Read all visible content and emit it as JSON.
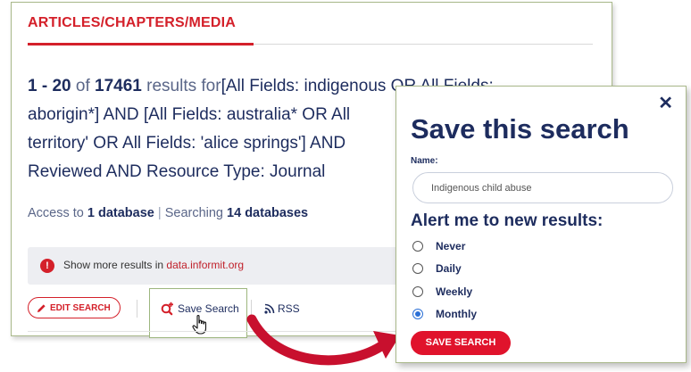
{
  "section": {
    "heading": "ARTICLES/CHAPTERS/MEDIA"
  },
  "results": {
    "range": "1 - 20",
    "of_word": "of",
    "total": "17461",
    "results_for": "results for",
    "line1_query": "[All Fields: indigenous OR All Fields:",
    "line2": "aborigin*] AND [All Fields: australia* OR All",
    "line3": "territory' OR All Fields: 'alice springs'] AND",
    "line4": "Reviewed AND Resource Type: Journal"
  },
  "access": {
    "access_to": "Access to",
    "db_count": "1 database",
    "separator": "|",
    "searching": "Searching",
    "searching_count": "14 databases"
  },
  "notice": {
    "icon": "!",
    "text": "Show more results in",
    "link": "data.informit.org"
  },
  "toolbar": {
    "edit_label": "EDIT SEARCH",
    "save_search_label": "Save Search",
    "rss_label": "RSS"
  },
  "modal": {
    "close": "✕",
    "title": "Save this search",
    "name_label": "Name:",
    "name_value": "Indigenous child abuse",
    "alert_title": "Alert me to new results:",
    "options": [
      {
        "label": "Never",
        "checked": false
      },
      {
        "label": "Daily",
        "checked": false
      },
      {
        "label": "Weekly",
        "checked": false
      },
      {
        "label": "Monthly",
        "checked": true
      }
    ],
    "save_label": "SAVE SEARCH"
  },
  "colors": {
    "brand_red": "#d4202a",
    "navy": "#1d2c5e",
    "radio_blue": "#2b6fd6",
    "highlight_border": "#9db67e"
  }
}
